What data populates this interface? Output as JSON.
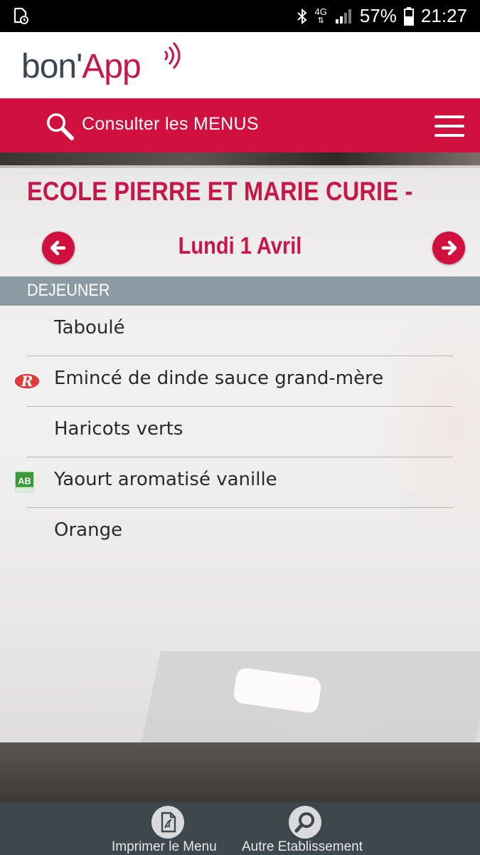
{
  "status_bar": {
    "network": "4G",
    "battery": "57%",
    "time": "21:27"
  },
  "header": {
    "logo_part1": "bon'",
    "logo_part2": "App"
  },
  "nav": {
    "menu_link": "Consulter les MENUS"
  },
  "content": {
    "school_name": "ECOLE PIERRE ET MARIE CURIE -",
    "day": "Lundi 1 Avril",
    "meal_section": "DEJEUNER",
    "items": [
      {
        "label": "Taboulé",
        "badge": ""
      },
      {
        "label": "Emincé de dinde sauce grand-mère",
        "badge": "label-rouge-icon"
      },
      {
        "label": "Haricots verts",
        "badge": ""
      },
      {
        "label": "Yaourt aromatisé vanille",
        "badge": "agriculture-biologique-icon"
      },
      {
        "label": "Orange",
        "badge": ""
      }
    ]
  },
  "toolbar": {
    "print_label": "Imprimer le Menu",
    "other_label": "Autre Etablissement"
  },
  "colors": {
    "brand_red": "#d0103f",
    "title_red": "#c8154a",
    "section_grey": "#8c9aa3",
    "toolbar_bg": "#3e474b"
  }
}
